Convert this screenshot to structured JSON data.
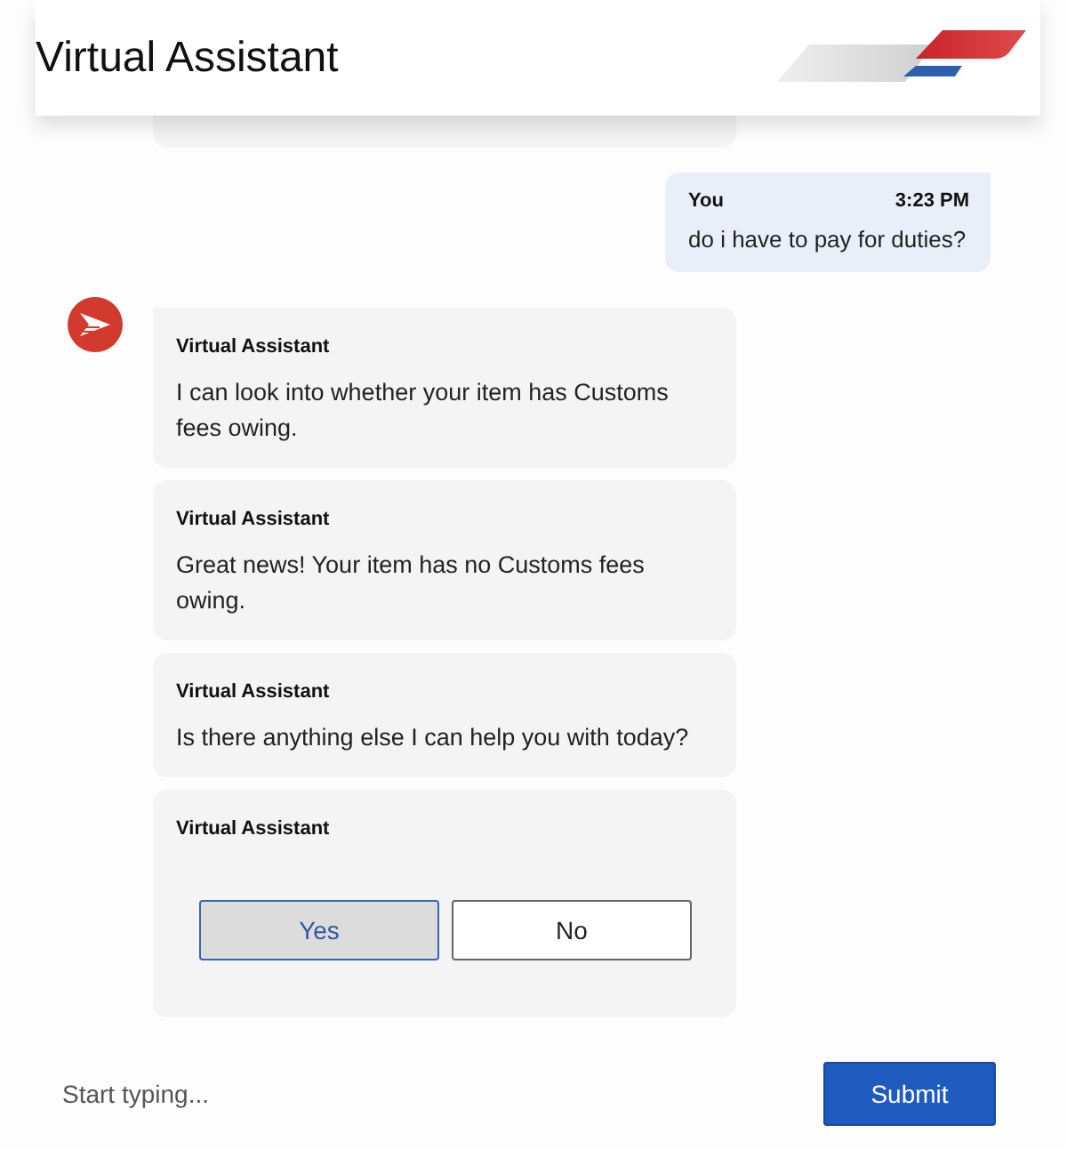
{
  "header": {
    "title": "Virtual Assistant"
  },
  "messages": [
    {
      "kind": "user",
      "sender": "You",
      "time": "3:23 PM",
      "text": "do i have to pay for duties?"
    },
    {
      "kind": "bot",
      "sender": "Virtual Assistant",
      "text": "I can look into whether your item has Customs fees owing."
    },
    {
      "kind": "bot",
      "sender": "Virtual Assistant",
      "text": "Great news! Your item has no Customs fees owing."
    },
    {
      "kind": "bot",
      "sender": "Virtual Assistant",
      "text": "Is there anything else I can help you with today?"
    },
    {
      "kind": "choices",
      "sender": "Virtual Assistant",
      "options": [
        {
          "label": "Yes",
          "selected": true
        },
        {
          "label": "No",
          "selected": false
        }
      ]
    }
  ],
  "composer": {
    "placeholder": "Start typing...",
    "submit": "Submit"
  }
}
